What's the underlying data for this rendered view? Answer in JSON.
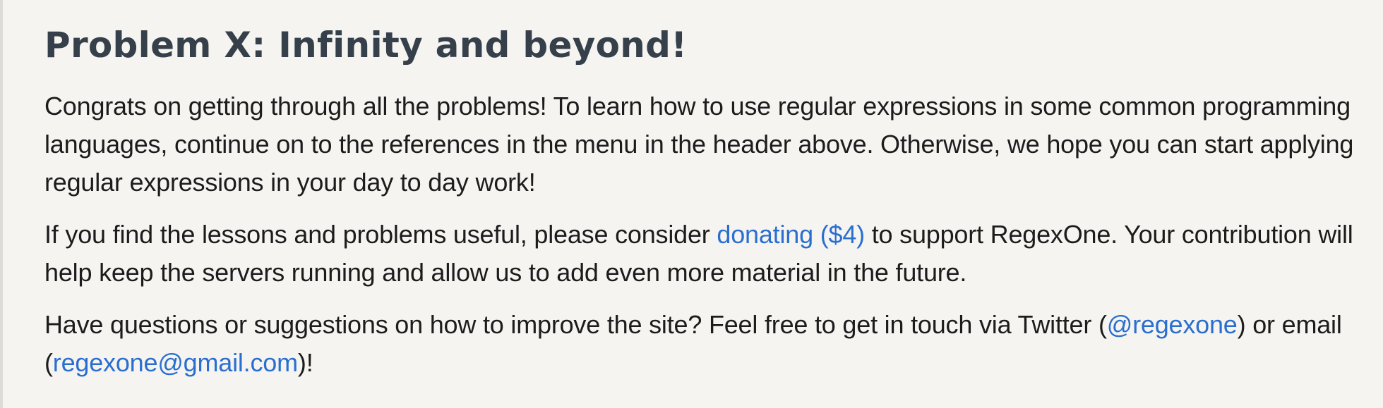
{
  "problem": {
    "title": "Problem X: Infinity and beyond!",
    "paragraph1": "Congrats on getting through all the problems! To learn how to use regular expressions in some common programming languages, continue on to the references in the menu in the header above. Otherwise, we hope you can start applying regular expressions in your day to day work!",
    "paragraph2": {
      "before": "If you find the lessons and problems useful, please consider ",
      "link": "donating ($4)",
      "after": " to support RegexOne. Your contribution will help keep the servers running and allow us to add even more material in the future."
    },
    "paragraph3": {
      "before": "Have questions or suggestions on how to improve the site? Feel free to get in touch via Twitter (",
      "twitter_link": "@regexone",
      "middle": ") or email (",
      "email_link": "regexone@gmail.com",
      "after": ")!"
    }
  },
  "colors": {
    "background": "#f5f4f1",
    "title": "#36404a",
    "text": "#1c1c1c",
    "link": "#2a6fcf"
  }
}
